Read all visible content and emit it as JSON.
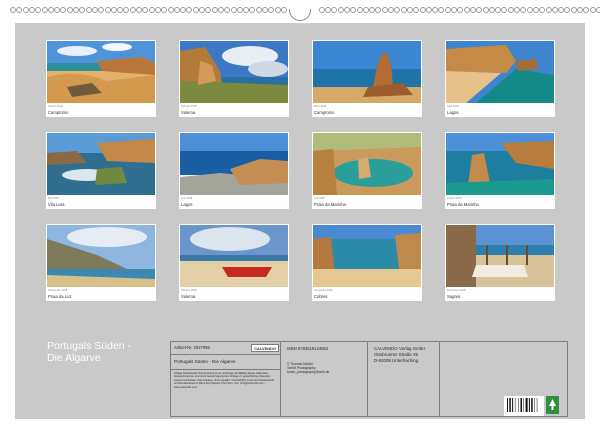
{
  "calendar": {
    "title_line1": "Portugals Süden -",
    "title_line2": "Die Algarve",
    "months": [
      {
        "caption": "Camptomo",
        "meta": "Januar  2018"
      },
      {
        "caption": "Salema",
        "meta": "Februar  2018"
      },
      {
        "caption": "Camptomo",
        "meta": "März  2018"
      },
      {
        "caption": "Lagos",
        "meta": "April  2018"
      },
      {
        "caption": "Vila Lara",
        "meta": "Mai  2018"
      },
      {
        "caption": "Lagos",
        "meta": "Juni  2018"
      },
      {
        "caption": "Praia da Marinha",
        "meta": "Juli  2018"
      },
      {
        "caption": "Praia da Marinha",
        "meta": "August  2018"
      },
      {
        "caption": "Praia da Luz",
        "meta": "September  2018"
      },
      {
        "caption": "Salema",
        "meta": "Oktober  2018"
      },
      {
        "caption": "Cobres",
        "meta": "November  2018"
      },
      {
        "caption": "Sagres",
        "meta": "Dezember  2018"
      }
    ]
  },
  "info": {
    "article": "Artikel-Nr. 2027096",
    "logo": "CALVENDO",
    "product_title": "Portugals Süden - Die Algarve",
    "legal": "Infolge bestehender Schutzrechte ist es untersagt, die Blätter dieses Kalenders herauszutrennen und ohne Genehmigung des Verlags zu gewerblichen Zwecken weiterzuverbreiten. Alle Angaben ohne Gewähr. CALVENDO produziert klimaneutral und klimabewusst in DE & EU (Papiere FSC Mix). Info: info@calvendo.com • www.calvendo.com",
    "isbn": "ISBN 9783516124552",
    "copyright": "© Thomas Minder",
    "copyright_sub": "TomM Photography",
    "copyright_mail": "tomm_photography@web.de",
    "publisher": "CALVENDO Verlag GmbH",
    "street": "Ottobrunner Straße 39",
    "city": "D-82008 Unterhaching"
  }
}
